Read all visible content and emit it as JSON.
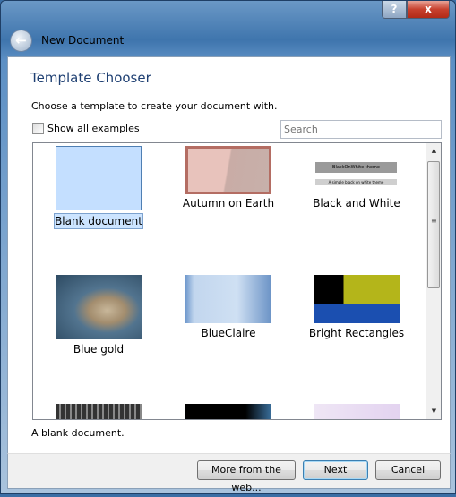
{
  "window": {
    "title": "New Document",
    "help_label": "?",
    "close_label": "x",
    "back_icon": "back-arrow-icon"
  },
  "header": {
    "title": "Template Chooser",
    "instruction": "Choose a template to create your document with."
  },
  "show_all": {
    "label": "Show all examples",
    "checked": false
  },
  "search": {
    "placeholder": "Search",
    "value": ""
  },
  "templates": [
    {
      "label": "Blank document",
      "selected": true
    },
    {
      "label": "Autumn on Earth",
      "selected": false
    },
    {
      "label": "Black and White",
      "selected": false,
      "thumb_title": "BlackOnWhite theme",
      "thumb_sub": "A simple black on white theme"
    },
    {
      "label": "Blue gold",
      "selected": false
    },
    {
      "label": "BlueClaire",
      "selected": false
    },
    {
      "label": "Bright Rectangles",
      "selected": false
    }
  ],
  "description": "A blank document.",
  "buttons": {
    "more": "More from the web...",
    "next": "Next",
    "cancel": "Cancel"
  },
  "colors": {
    "selection": "#cce4ff",
    "heading": "#1e3f72"
  }
}
